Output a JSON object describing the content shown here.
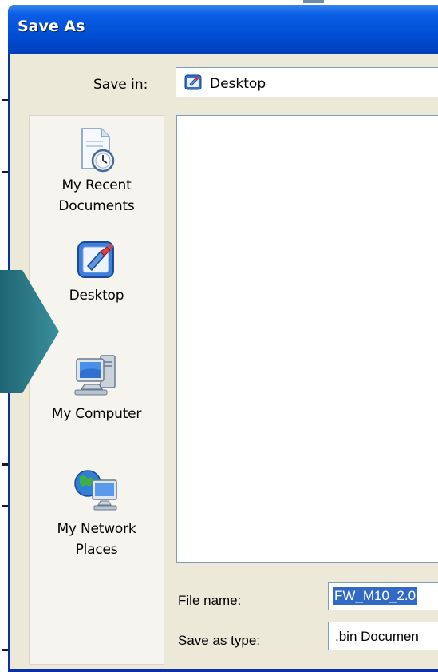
{
  "window": {
    "title": "Save As"
  },
  "save_in": {
    "label": "Save in:",
    "value": "Desktop",
    "icon": "desktop-icon"
  },
  "places_bar": {
    "items": [
      {
        "label_line1": "My Recent",
        "label_line2": "Documents",
        "icon": "recent-documents-icon"
      },
      {
        "label_line1": "Desktop",
        "label_line2": "",
        "icon": "desktop-icon"
      },
      {
        "label_line1": "My Computer",
        "label_line2": "",
        "icon": "computer-icon"
      },
      {
        "label_line1": "My Network",
        "label_line2": "Places",
        "icon": "network-places-icon"
      }
    ]
  },
  "file_name": {
    "label": "File name:",
    "value": "FW_M10_2.0"
  },
  "save_as_type": {
    "label": "Save as type:",
    "value": ".bin Documen"
  },
  "colors": {
    "titlebar": "#0250d6",
    "dialog_face": "#ece9d8",
    "selection": "#316ac5",
    "arrow": "#2c7a8a"
  }
}
